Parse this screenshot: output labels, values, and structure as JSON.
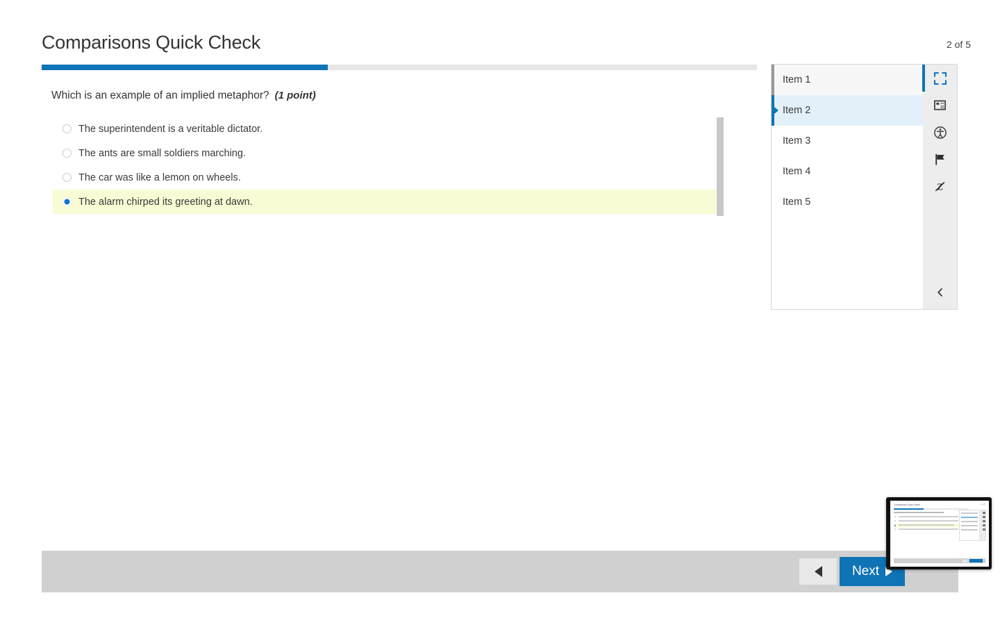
{
  "header": {
    "title": "Comparisons Quick Check",
    "counter": "2 of 5",
    "progress_percent": 40,
    "accent_color": "#0f74b5"
  },
  "question": {
    "text": "Which is an example of an implied metaphor?",
    "points": "(1 point)",
    "options": [
      {
        "label": "The superintendent is a veritable dictator.",
        "selected": false
      },
      {
        "label": "The ants are small soldiers marching.",
        "selected": false
      },
      {
        "label": "The car was like a lemon on wheels.",
        "selected": false
      },
      {
        "label": "The alarm chirped its greeting at dawn.",
        "selected": true
      }
    ],
    "highlight_color": "#f8fbd4"
  },
  "item_panel": {
    "items": [
      {
        "label": "Item 1",
        "state": "visited"
      },
      {
        "label": "Item 2",
        "state": "current"
      },
      {
        "label": "Item 3",
        "state": "unvisited"
      },
      {
        "label": "Item 4",
        "state": "unvisited"
      },
      {
        "label": "Item 5",
        "state": "unvisited"
      }
    ]
  },
  "toolbar": {
    "icons": [
      {
        "name": "fullscreen-icon",
        "active": true
      },
      {
        "name": "calculator-icon",
        "active": false
      },
      {
        "name": "accessibility-icon",
        "active": false
      },
      {
        "name": "flag-icon",
        "active": false
      },
      {
        "name": "eliminate-choice-icon",
        "active": false
      }
    ],
    "collapse_icon": "chevron-left-icon"
  },
  "footer": {
    "previous_label": "",
    "next_label": "Next"
  },
  "thumbnail": {
    "title": "Comparisons Quick Check",
    "counter": "2 of 5"
  }
}
